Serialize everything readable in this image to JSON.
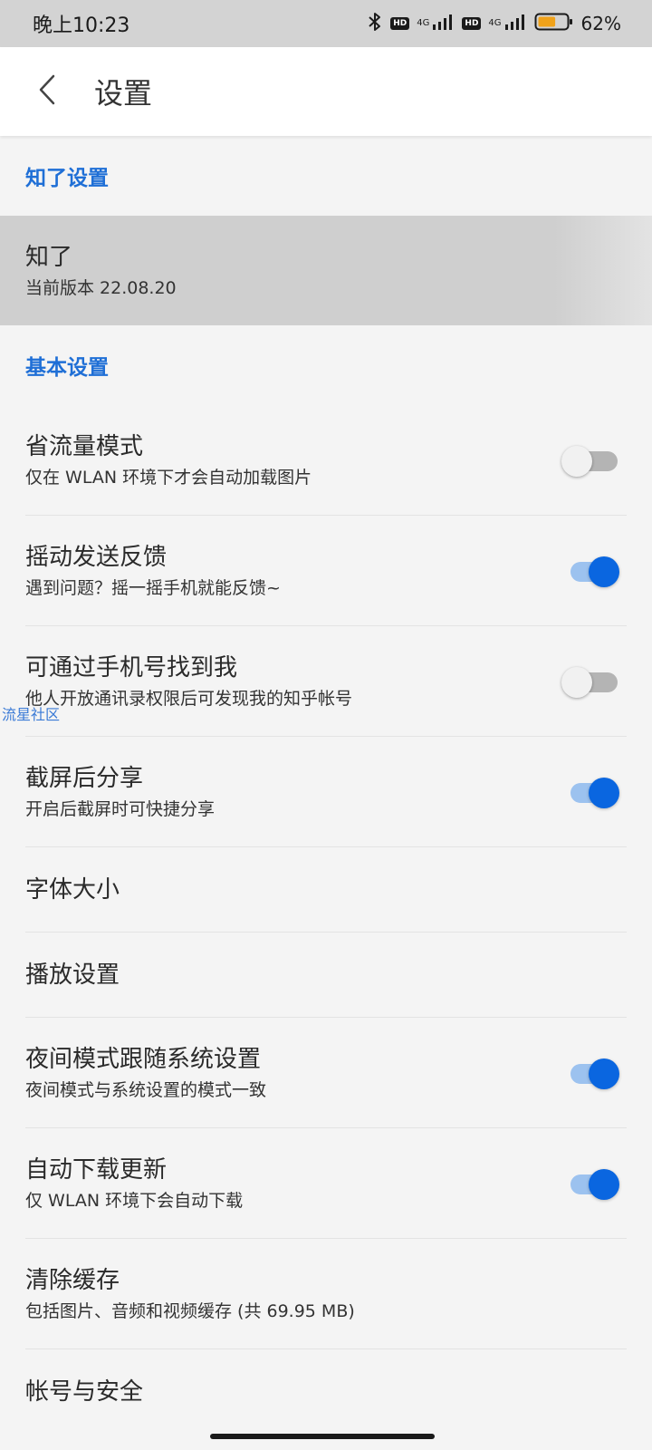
{
  "status_bar": {
    "time": "晚上10:23",
    "hd_label": "HD",
    "network_type": "4G",
    "battery_percent": "62%",
    "battery_level": 0.62
  },
  "app_bar": {
    "title": "设置",
    "back_icon": "chevron-left-icon"
  },
  "sections": {
    "zhiliao_header": "知了设置",
    "basic_header": "基本设置"
  },
  "about": {
    "title": "知了",
    "subtitle": "当前版本 22.08.20"
  },
  "settings": [
    {
      "title": "省流量模式",
      "subtitle": "仅在 WLAN 环境下才会自动加载图片",
      "toggle": false
    },
    {
      "title": "摇动发送反馈",
      "subtitle": "遇到问题？摇一摇手机就能反馈~",
      "toggle": true
    },
    {
      "title": "可通过手机号找到我",
      "subtitle": "他人开放通讯录权限后可发现我的知乎帐号",
      "toggle": false
    },
    {
      "title": "截屏后分享",
      "subtitle": "开启后截屏时可快捷分享",
      "toggle": true
    },
    {
      "title": "字体大小"
    },
    {
      "title": "播放设置"
    },
    {
      "title": "夜间模式跟随系统设置",
      "subtitle": "夜间模式与系统设置的模式一致",
      "toggle": true
    },
    {
      "title": "自动下载更新",
      "subtitle": "仅 WLAN 环境下会自动下载",
      "toggle": true
    },
    {
      "title": "清除缓存",
      "subtitle": "包括图片、音频和视频缓存 (共 69.95 MB)"
    },
    {
      "title": "帐号与安全"
    }
  ],
  "watermark": "流星社区",
  "colors": {
    "accent": "#0a66e0",
    "section_header": "#1f6fd6",
    "toggle_on_track": "#9cc2ef",
    "toggle_off_track": "#b4b4b4"
  }
}
